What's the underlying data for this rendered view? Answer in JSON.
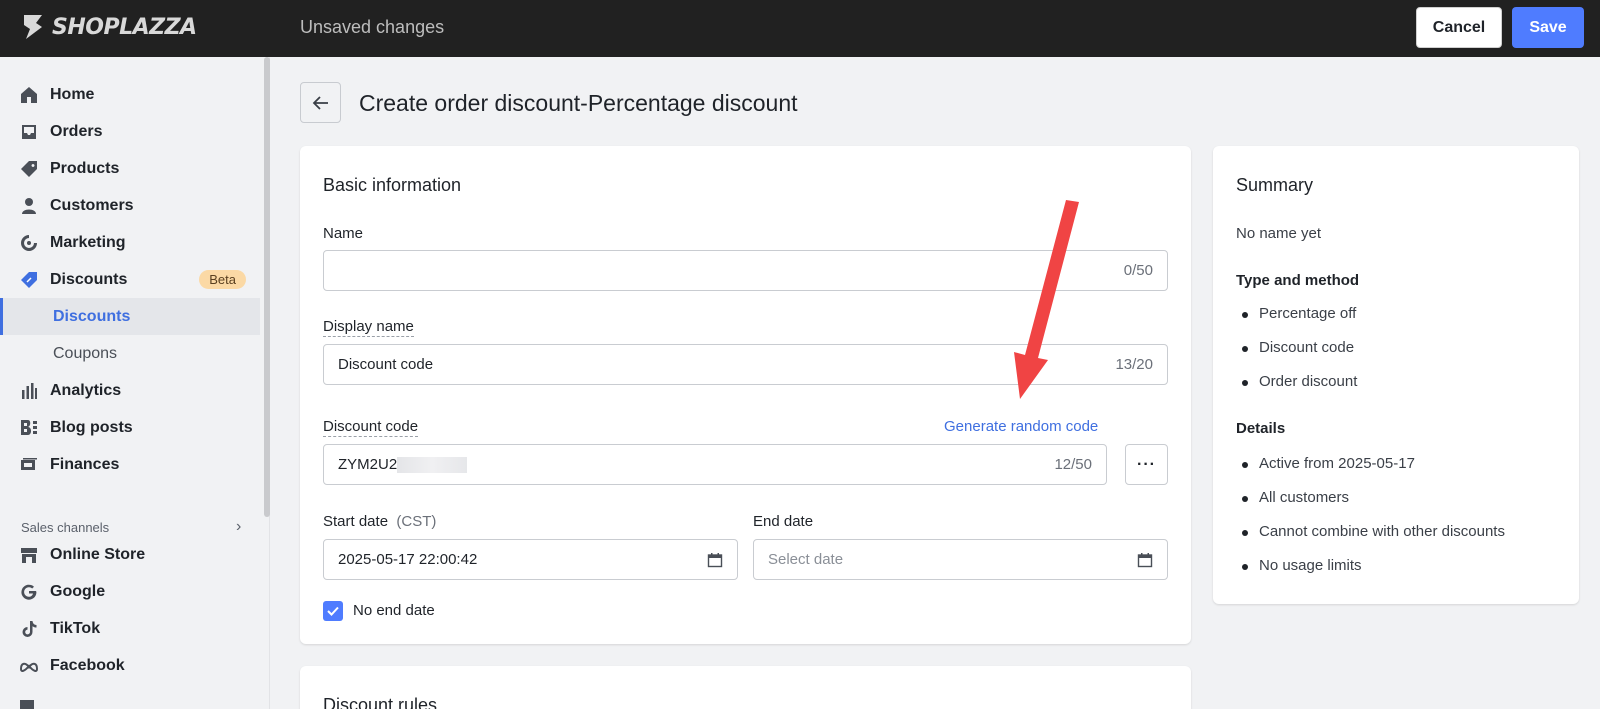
{
  "topbar": {
    "brand": "SHOPLAZZA",
    "status": "Unsaved changes",
    "cancel_label": "Cancel",
    "save_label": "Save"
  },
  "sidebar": {
    "items": [
      {
        "label": "Home",
        "icon": "home-icon"
      },
      {
        "label": "Orders",
        "icon": "inbox-icon"
      },
      {
        "label": "Products",
        "icon": "tag-icon"
      },
      {
        "label": "Customers",
        "icon": "person-icon"
      },
      {
        "label": "Marketing",
        "icon": "target-icon"
      },
      {
        "label": "Discounts",
        "icon": "discount-tag-icon",
        "badge": "Beta"
      }
    ],
    "subitems": [
      {
        "label": "Discounts",
        "active": true
      },
      {
        "label": "Coupons",
        "active": false
      }
    ],
    "items2": [
      {
        "label": "Analytics",
        "icon": "bar-chart-icon"
      },
      {
        "label": "Blog posts",
        "icon": "blog-icon"
      },
      {
        "label": "Finances",
        "icon": "finance-icon"
      }
    ],
    "section_label": "Sales channels",
    "channels": [
      {
        "label": "Online Store",
        "icon": "store-icon"
      },
      {
        "label": "Google",
        "icon": "google-icon"
      },
      {
        "label": "TikTok",
        "icon": "tiktok-icon"
      },
      {
        "label": "Facebook",
        "icon": "meta-icon"
      }
    ]
  },
  "page": {
    "title": "Create order discount-Percentage discount"
  },
  "basic_info": {
    "title": "Basic information",
    "name_label": "Name",
    "name_value": "",
    "name_count": "0/50",
    "display_name_label": "Display name",
    "display_name_value": "Discount code",
    "display_name_count": "13/20",
    "discount_code_label": "Discount code",
    "generate_link": "Generate random code",
    "discount_code_value": "ZYM2U2",
    "discount_code_count": "12/50",
    "more_label": "···",
    "start_date_label": "Start date",
    "start_date_tz": "(CST)",
    "start_date_value": "2025-05-17 22:00:42",
    "end_date_label": "End date",
    "end_date_placeholder": "Select date",
    "no_end_date_label": "No end date",
    "no_end_date_checked": true
  },
  "discount_rules": {
    "title": "Discount rules"
  },
  "summary": {
    "title": "Summary",
    "name": "No name yet",
    "type_heading": "Type and method",
    "type_items": [
      "Percentage off",
      "Discount code",
      "Order discount"
    ],
    "details_heading": "Details",
    "details_items": [
      "Active from 2025-05-17",
      "All customers",
      "Cannot combine with other discounts",
      "No usage limits"
    ]
  },
  "colors": {
    "accent": "#4f7cff",
    "link": "#3f6fe0",
    "topbar": "#212121",
    "annotation_arrow": "#f04444",
    "beta_badge": "#fbd9a5"
  }
}
